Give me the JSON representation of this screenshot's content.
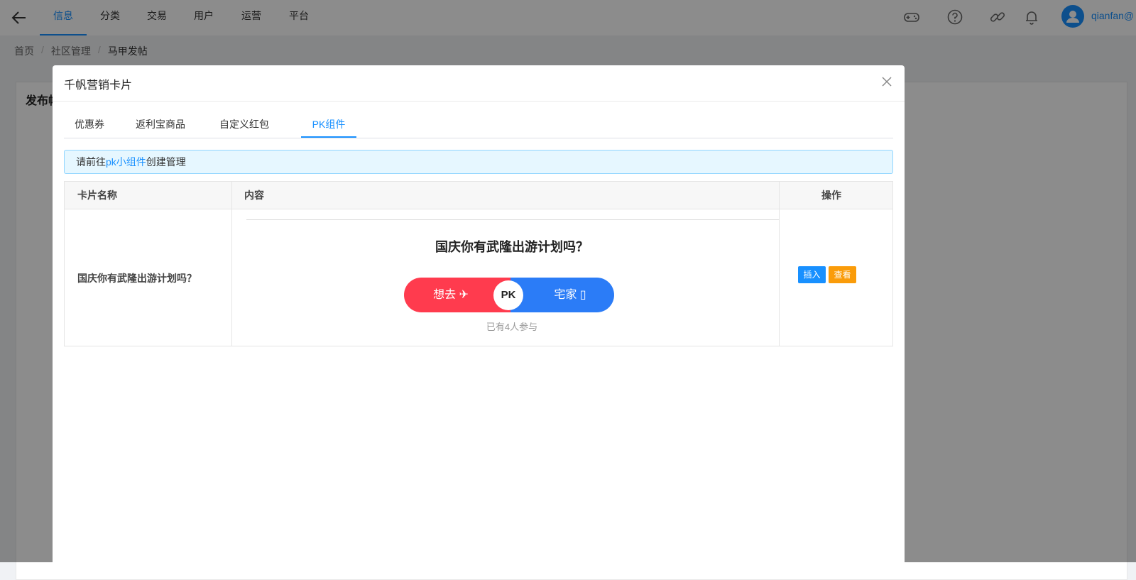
{
  "topnav": {
    "items": [
      {
        "label": "信息",
        "active": true
      },
      {
        "label": "分类"
      },
      {
        "label": "交易"
      },
      {
        "label": "用户"
      },
      {
        "label": "运营"
      },
      {
        "label": "平台"
      }
    ],
    "username": "qianfan@"
  },
  "breadcrumb": [
    "首页",
    "社区管理",
    "马甲发帖"
  ],
  "background_card": {
    "title": "发布帖"
  },
  "modal": {
    "title": "千帆营销卡片",
    "tabs": [
      {
        "label": "优惠券"
      },
      {
        "label": "返利宝商品"
      },
      {
        "label": "自定义红包"
      },
      {
        "label": "PK组件",
        "active": true
      }
    ],
    "alert": {
      "prefix": "请前往",
      "link": "pk小组件",
      "suffix": "创建管理"
    },
    "table": {
      "headers": [
        "卡片名称",
        "内容",
        "操作"
      ],
      "rows": [
        {
          "name": "国庆你有武隆出游计划吗？",
          "pk": {
            "question": "国庆你有武隆出游计划吗？",
            "left_option": "想去 ✈",
            "right_option": "宅家 ▯",
            "badge": "PK",
            "participants": "已有4人参与"
          },
          "actions": {
            "insert": "插入",
            "view": "查看"
          }
        }
      ]
    }
  },
  "colors": {
    "primary": "#1890ff",
    "pk_left": "#ff3b4e",
    "pk_right": "#2b7cf7",
    "view_button": "#fa9c0a"
  },
  "icons": [
    "back-arrow-icon",
    "gamepad-icon",
    "help-icon",
    "link-icon",
    "bell-icon",
    "user-icon",
    "close-icon"
  ]
}
